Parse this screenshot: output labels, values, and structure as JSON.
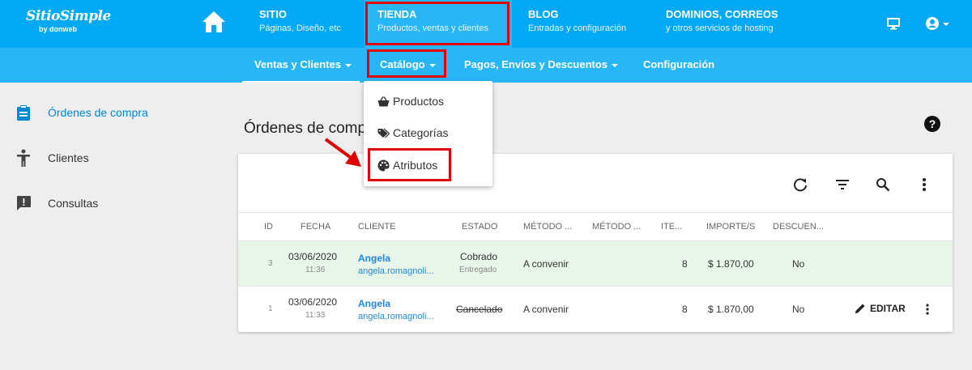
{
  "logo": {
    "main": "SitioSimple",
    "sub": "by donweb"
  },
  "topnav": [
    {
      "title": "SITIO",
      "subtitle": "Páginas, Diseño, etc"
    },
    {
      "title": "TIENDA",
      "subtitle": "Productos, ventas y clientes"
    },
    {
      "title": "BLOG",
      "subtitle": "Entradas y configuración"
    },
    {
      "title": "DOMINIOS, CORREOS",
      "subtitle": "y otros servicios de hosting"
    }
  ],
  "subnav": {
    "ventas": "Ventas y Clientes",
    "catalogo": "Catálogo",
    "pagos": "Pagos, Envíos y Descuentos",
    "config": "Configuración"
  },
  "dropdown": {
    "productos": "Productos",
    "categorias": "Categorías",
    "atributos": "Atributos"
  },
  "sidebar": {
    "ordenes": "Órdenes de compra",
    "clientes": "Clientes",
    "consultas": "Consultas"
  },
  "page": {
    "title": "Órdenes de compra",
    "help": "?"
  },
  "table": {
    "headers": [
      "ID",
      "FECHA",
      "CLIENTE",
      "ESTADO",
      "MÉTODO ...",
      "MÉTODO ...",
      "ITE...",
      "IMPORTE/S",
      "DESCUEN..."
    ],
    "rows": [
      {
        "id": "3",
        "date": "03/06/2020",
        "time": "11:36",
        "client": "Angela",
        "email": "angela.romagnoli...",
        "status": "Cobrado",
        "substatus": "Entregado",
        "method": "A convenir",
        "items": "8",
        "amount": "$ 1.870,00",
        "discount": "No"
      },
      {
        "id": "1",
        "date": "03/06/2020",
        "time": "11:33",
        "client": "Angela",
        "email": "angela.romagnoli...",
        "status": "Cancelado",
        "method": "A convenir",
        "items": "8",
        "amount": "$ 1.870,00",
        "discount": "No",
        "edit": "EDITAR"
      }
    ]
  },
  "colors": {
    "topbar": "#03a9f4",
    "subbar": "#29b6f6",
    "active_nav": "#29b6f6",
    "highlight": "#e10000",
    "row_highlight": "#e8f5e9",
    "link": "#1e88e5"
  }
}
